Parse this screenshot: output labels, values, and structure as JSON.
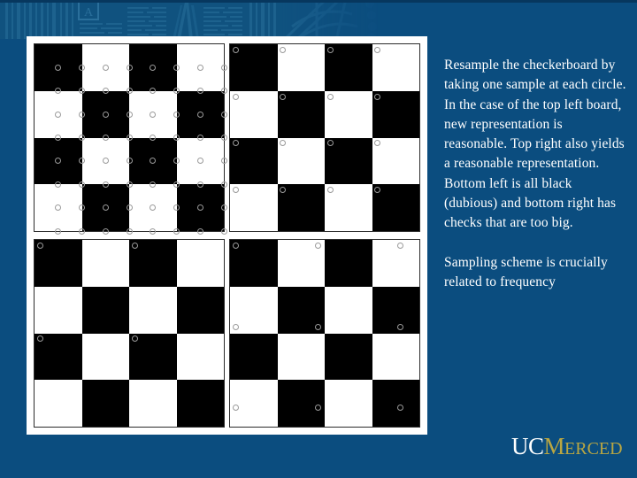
{
  "slide": {
    "background_color": "#0b4d7f",
    "panel_background": "#ffffff",
    "text_color": "#ffffff"
  },
  "decoration": {
    "top_band_name": "uc-merced-book-and-sunburst-watermark",
    "letter_tile": "A"
  },
  "body_text": {
    "paragraph_1": "Resample the checkerboard by taking one sample at each circle. In the case of the top left board, new representation is reasonable. Top right also yields a reasonable representation. Bottom left is all black (dubious) and bottom right has checks that are too big.",
    "paragraph_2": "Sampling scheme is crucially related to frequency"
  },
  "logo": {
    "uc": "UC",
    "m": "M",
    "erced": "ERCED",
    "uc_color": "#ffffff",
    "merced_color": "#b9a642"
  },
  "chart_data": {
    "type": "heatmap",
    "title": "Resample the checkerboard by taking one sample at each circle",
    "xlabel": "",
    "ylabel": "",
    "grid": false,
    "legend": "none",
    "boards": [
      {
        "id": "top-left",
        "position": "top-left",
        "checker_rows": 4,
        "checker_cols": 4,
        "top_left_cell": "black",
        "sample_rows": 8,
        "sample_cols": 8,
        "sample_offset_x_pct": 12.5,
        "sample_offset_y_pct": 12.5,
        "sample_step_x_pct": 12.5,
        "sample_step_y_pct": 12.5,
        "annotation": "new representation is reasonable"
      },
      {
        "id": "top-right",
        "position": "top-right",
        "checker_rows": 4,
        "checker_cols": 4,
        "top_left_cell": "black",
        "sample_rows": 4,
        "sample_cols": 4,
        "sample_offset_x_pct": 3.0,
        "sample_offset_y_pct": 3.0,
        "sample_step_x_pct": 25.0,
        "sample_step_y_pct": 25.0,
        "annotation": "also yields a reasonable representation"
      },
      {
        "id": "bottom-left",
        "position": "bottom-left",
        "checker_rows": 4,
        "checker_cols": 4,
        "top_left_cell": "black",
        "sample_rows": 2,
        "sample_cols": 2,
        "sample_offset_x_pct": 3.0,
        "sample_offset_y_pct": 3.0,
        "sample_step_x_pct": 50.0,
        "sample_step_y_pct": 50.0,
        "annotation": "all black (dubious)"
      },
      {
        "id": "bottom-right",
        "position": "bottom-right",
        "checker_rows": 4,
        "checker_cols": 4,
        "top_left_cell": "black",
        "sample_rows": 3,
        "sample_cols": 3,
        "sample_offset_x_pct": 3.0,
        "sample_offset_y_pct": 3.0,
        "sample_step_x_pct": 43.5,
        "sample_step_y_pct": 43.5,
        "annotation": "has checks that are too big"
      }
    ],
    "colors": {
      "black": "#000000",
      "white": "#ffffff",
      "sample_ring": "#9a9a9a"
    }
  }
}
